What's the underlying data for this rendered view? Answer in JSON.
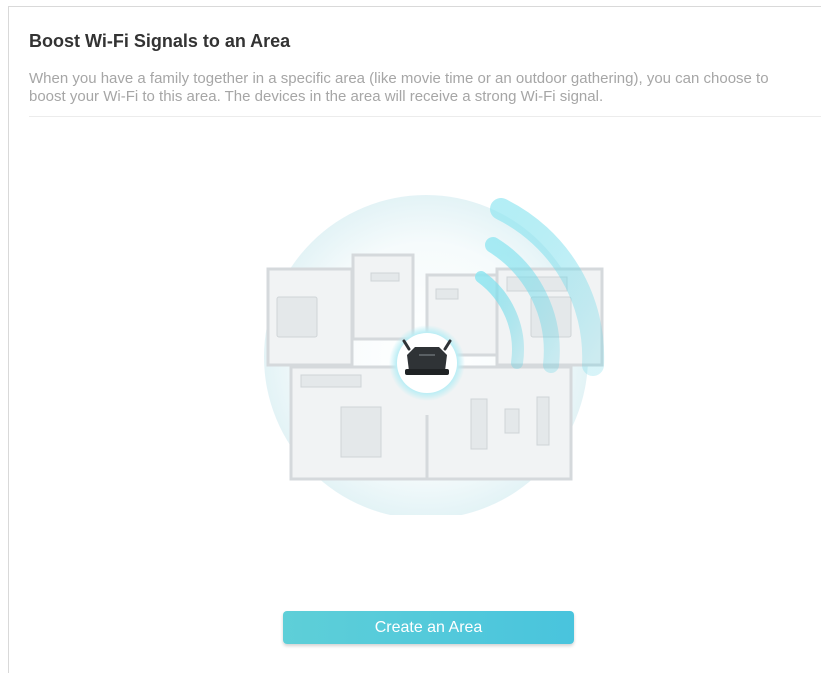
{
  "panel": {
    "title": "Boost Wi-Fi Signals to an Area",
    "description": "When you have a family together in a specific area (like movie time or an outdoor gathering), you can choose to boost your Wi-Fi to this area. The devices in the area will receive a strong Wi-Fi signal."
  },
  "illustration": {
    "icons": [
      "floor-plan-illustration",
      "router-icon",
      "wifi-signal-waves-icon"
    ],
    "colors": {
      "signal": "#4fd0e3",
      "glow": "#dff4f8"
    }
  },
  "actions": {
    "create_label": "Create an Area",
    "button_color": "#52c8dc"
  }
}
